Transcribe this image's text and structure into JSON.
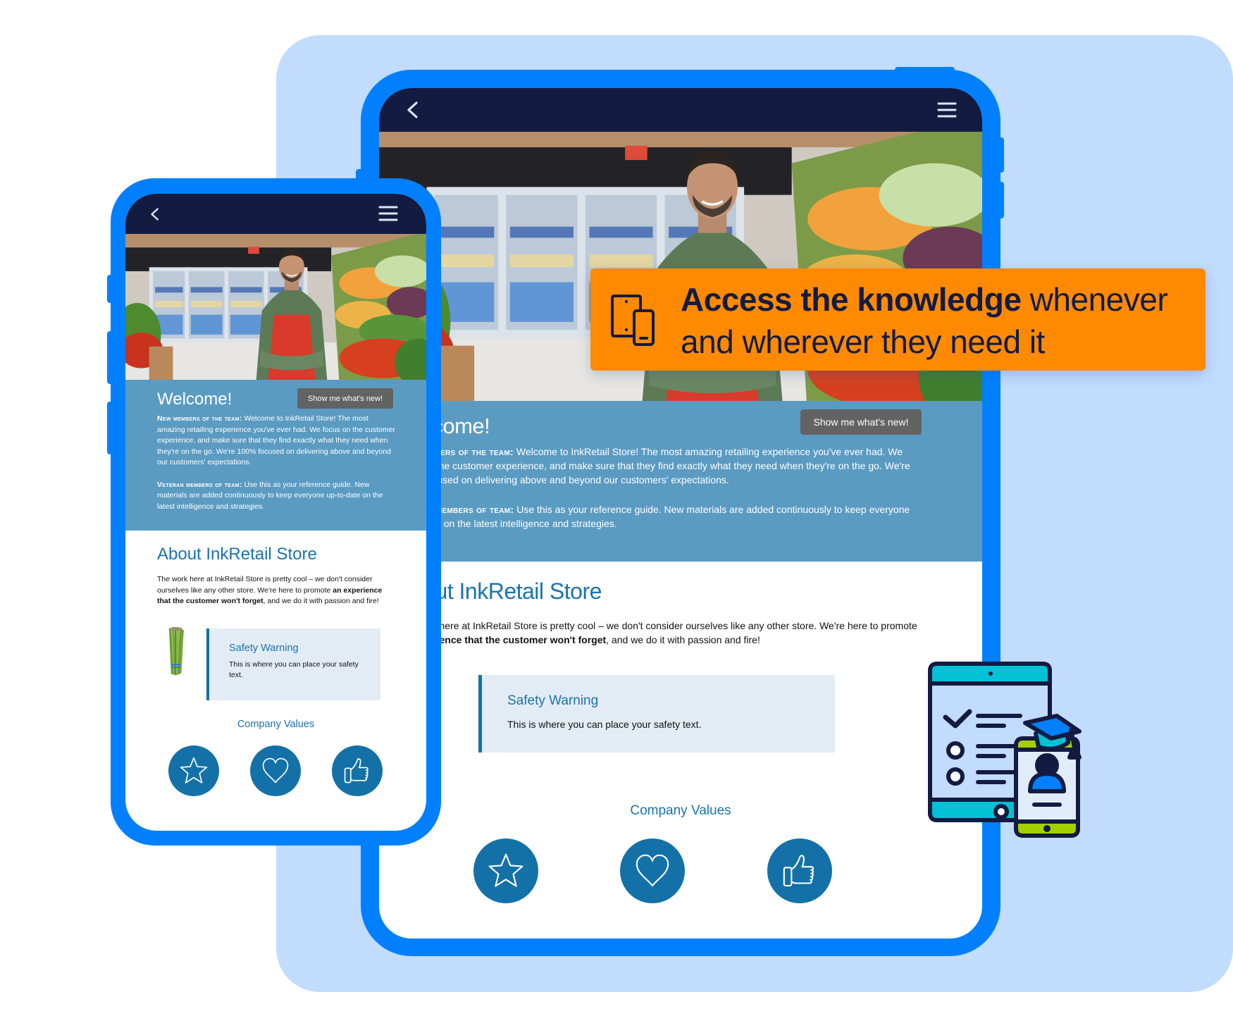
{
  "callout": {
    "icon": "devices-icon",
    "bold_text": "Access the knowledge",
    "text_line1_rest": " whenever",
    "text_line2": "and wherever they need it",
    "color": "#ff8a00"
  },
  "colors": {
    "device_frame": "#0080ff",
    "header_bar": "#131b41",
    "welcome_bg": "#5b9bc2",
    "accent_blue": "#1471a8",
    "background_panel": "#c2dcfd"
  },
  "app": {
    "header": {
      "back_icon": "chevron-left-icon",
      "menu_icon": "hamburger-menu-icon"
    },
    "welcome": {
      "title": "Welcome!",
      "button_label": "Show me what's new!",
      "new_members_label": "New members of the team:",
      "new_members_text": " Welcome to InkRetail Store!  The most amazing retailing experience you've ever had.  We focus on the customer experience, and make sure that they find exactly what they need when they're on the go.  We're 100% focused on delivering above and beyond our customers' expectations.",
      "veteran_label": "Veteran members of team:",
      "veteran_text": " Use this as your reference guide. New materials are added continuously to keep everyone up-to-date on the latest intelligence and strategies."
    },
    "about": {
      "title": "About InkRetail Store",
      "text_before": "The work here at InkRetail Store is pretty cool – we don't consider ourselves like any other store.  We're here to promote ",
      "text_bold": "an experience that the customer won't forget",
      "text_after": ", and we do it with passion and fire!"
    },
    "safety": {
      "title": "Safety Warning",
      "text": "This is where you can place your safety text."
    },
    "values": {
      "title": "Company Values",
      "items": [
        {
          "icon": "star-icon",
          "label": "star"
        },
        {
          "icon": "heart-icon",
          "label": "heart"
        },
        {
          "icon": "thumbs-up-icon",
          "label": "thumbs up"
        }
      ]
    }
  },
  "illustration": {
    "name": "mobile-learning-illustration"
  }
}
